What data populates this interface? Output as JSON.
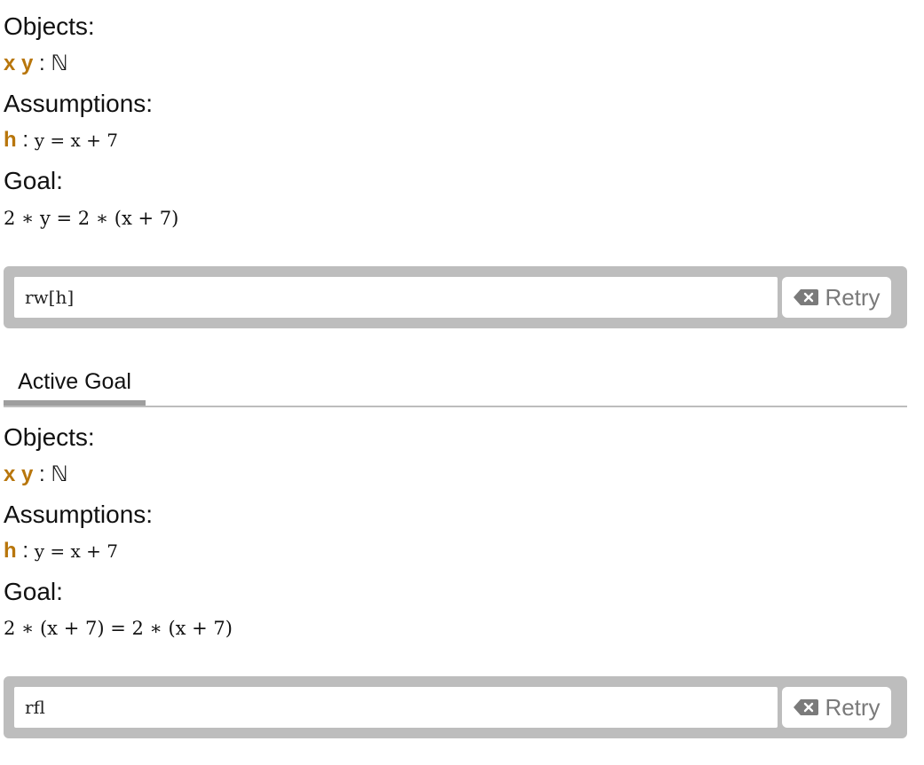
{
  "block1": {
    "objects_heading": "Objects:",
    "objects_vars": "x y",
    "objects_type": "ℕ",
    "assumptions_heading": "Assumptions:",
    "hyp_name": "h",
    "hyp_stmt": "y = x + 7",
    "goal_heading": "Goal:",
    "goal_stmt": "2 ∗ y = 2 ∗ (x + 7)",
    "command": "rw[h]",
    "retry_label": "Retry"
  },
  "tab": {
    "label": "Active Goal"
  },
  "block2": {
    "objects_heading": "Objects:",
    "objects_vars": "x y",
    "objects_type": "ℕ",
    "assumptions_heading": "Assumptions:",
    "hyp_name": "h",
    "hyp_stmt": "y = x + 7",
    "goal_heading": "Goal:",
    "goal_stmt": "2 ∗ (x + 7) = 2 ∗ (x + 7)",
    "command": "rfl",
    "retry_label": "Retry"
  },
  "colors": {
    "var_color": "#b8760c",
    "bar_gray": "#bdbdbd",
    "retry_text": "#7a7a7a"
  },
  "icons": {
    "retry": "backspace-icon"
  }
}
